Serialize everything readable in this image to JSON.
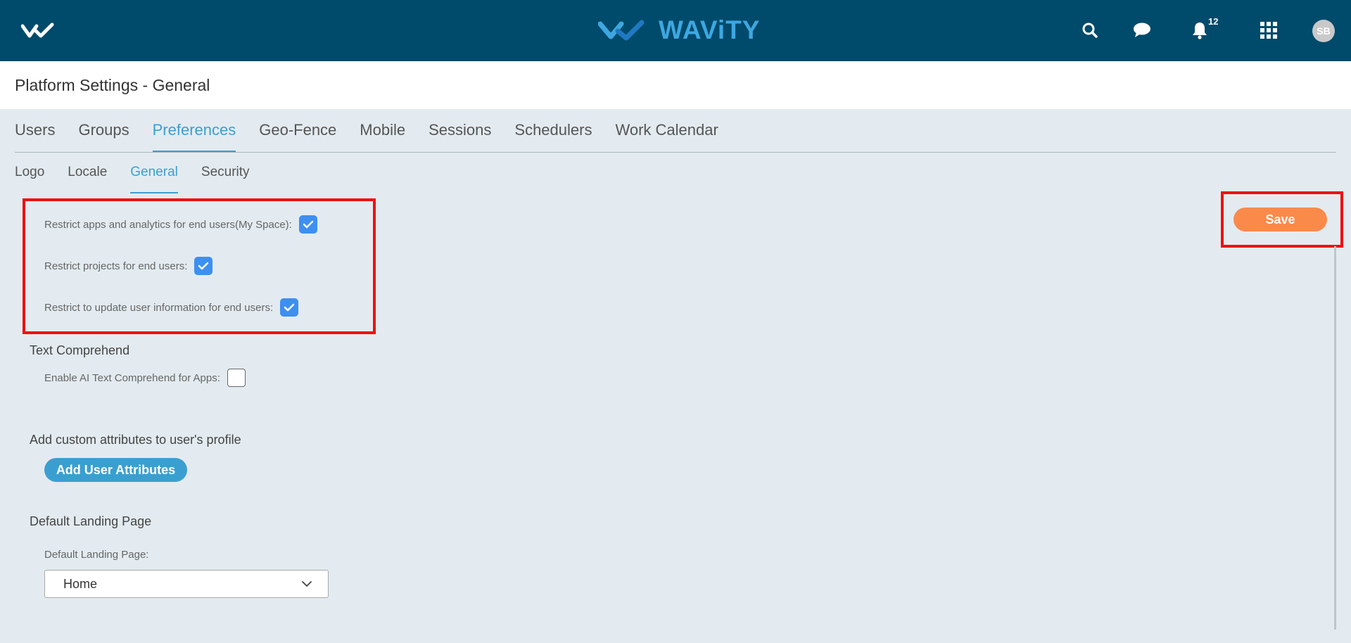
{
  "header": {
    "brand": "WAViTY",
    "icons": [
      "logo-mark",
      "search-icon",
      "chat-icon",
      "bell-icon",
      "apps-grid-icon"
    ],
    "notification_count": "12",
    "avatar_initials": "SB",
    "colors": {
      "bar": "#004a6b",
      "brand": "#3ea7e0"
    }
  },
  "page": {
    "title": "Platform Settings - General"
  },
  "tabs": [
    {
      "label": "Users",
      "active": false
    },
    {
      "label": "Groups",
      "active": false
    },
    {
      "label": "Preferences",
      "active": true
    },
    {
      "label": "Geo-Fence",
      "active": false
    },
    {
      "label": "Mobile",
      "active": false
    },
    {
      "label": "Sessions",
      "active": false
    },
    {
      "label": "Schedulers",
      "active": false
    },
    {
      "label": "Work Calendar",
      "active": false
    }
  ],
  "subtabs": [
    {
      "label": "Logo",
      "active": false
    },
    {
      "label": "Locale",
      "active": false
    },
    {
      "label": "General",
      "active": true
    },
    {
      "label": "Security",
      "active": false
    }
  ],
  "restrictions": [
    {
      "label": "Restrict apps and analytics for end users(My Space):",
      "checked": true
    },
    {
      "label": "Restrict projects for end users:",
      "checked": true
    },
    {
      "label": "Restrict to update user information for end users:",
      "checked": true
    }
  ],
  "text_comprehend": {
    "heading": "Text Comprehend",
    "option_label": "Enable AI Text Comprehend for Apps:",
    "checked": false
  },
  "custom_attributes": {
    "heading": "Add custom attributes to user's profile",
    "button_label": "Add User Attributes"
  },
  "landing_page": {
    "heading": "Default Landing Page",
    "field_label": "Default Landing Page:",
    "selected": "Home"
  },
  "actions": {
    "save_label": "Save"
  },
  "colors": {
    "accent": "#3a9fd0",
    "checkbox": "#3d8ff0",
    "save": "#fa8a4a",
    "highlight": "#ee1111"
  }
}
